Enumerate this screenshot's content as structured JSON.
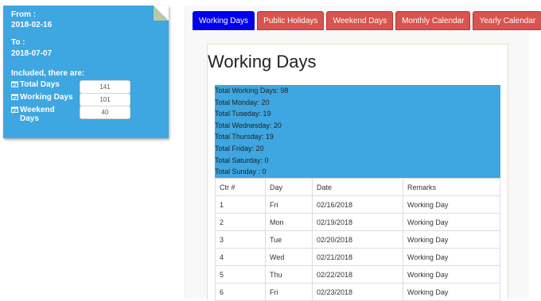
{
  "note": {
    "from_label": "From :",
    "from_value": "2018-02-16",
    "to_label": "To :",
    "to_value": "2018-07-07",
    "included_label": "Included, there are:",
    "rows": [
      {
        "label": "Total Days",
        "value": "141"
      },
      {
        "label": "Working Days",
        "value": "101"
      },
      {
        "label": "Weekend Days",
        "value": "40"
      }
    ]
  },
  "tabs": [
    {
      "label": "Working Days",
      "active": true
    },
    {
      "label": "Public Holidays",
      "active": false
    },
    {
      "label": "Weekend Days",
      "active": false
    },
    {
      "label": "Monthly Calendar",
      "active": false
    },
    {
      "label": "Yearly Calendar",
      "active": false
    }
  ],
  "main": {
    "title": "Working Days",
    "summary": [
      "Total Working Days: 98",
      "Total Monday: 20",
      "Total Tuseday: 19",
      "Total Wednesday: 20",
      "Total Thursday: 19",
      "Total Friday: 20",
      "Total Saturday: 0",
      "Total Sunday : 0"
    ],
    "table": {
      "headers": [
        "Ctr #",
        "Day",
        "Date",
        "Remarks"
      ],
      "rows": [
        [
          "1",
          "Fri",
          "02/16/2018",
          "Working Day"
        ],
        [
          "2",
          "Mon",
          "02/19/2018",
          "Working Day"
        ],
        [
          "3",
          "Tue",
          "02/20/2018",
          "Working Day"
        ],
        [
          "4",
          "Wed",
          "02/21/2018",
          "Working Day"
        ],
        [
          "5",
          "Thu",
          "02/22/2018",
          "Working Day"
        ],
        [
          "6",
          "Fri",
          "02/23/2018",
          "Working Day"
        ]
      ]
    }
  },
  "colors": {
    "note_bg": "#3ea6e0",
    "tab_active": "#0000ee",
    "tab_inactive": "#d9534f"
  },
  "icons": [
    "calendar-check-icon"
  ]
}
